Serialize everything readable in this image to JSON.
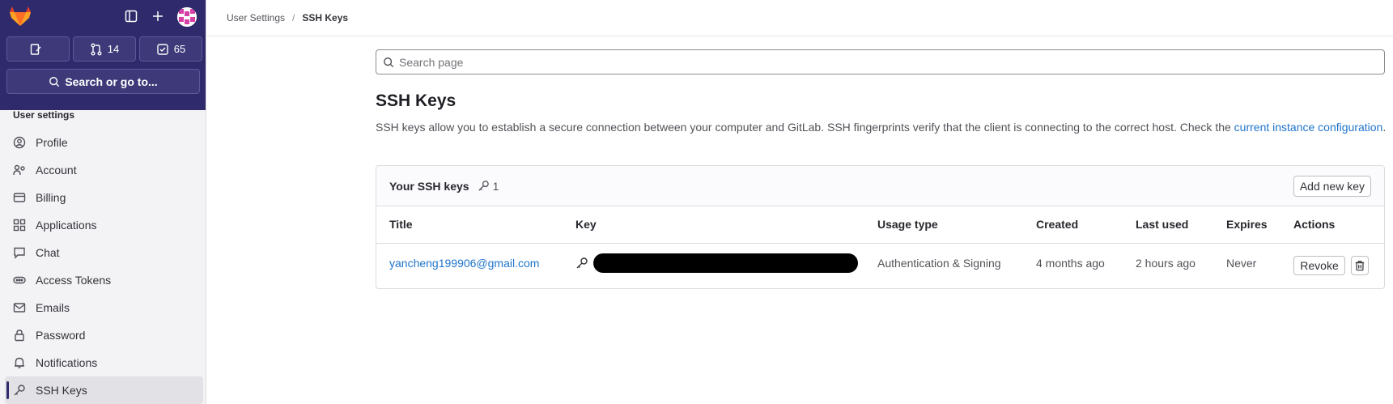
{
  "header": {
    "counters": [
      {
        "icon": "issues-icon",
        "value": ""
      },
      {
        "icon": "merge-request-icon",
        "value": "14"
      },
      {
        "icon": "todo-icon",
        "value": "65"
      }
    ],
    "search_label": "Search or go to..."
  },
  "sidebar": {
    "section_title": "User settings",
    "items": [
      {
        "label": "Profile",
        "icon": "profile-icon"
      },
      {
        "label": "Account",
        "icon": "account-icon"
      },
      {
        "label": "Billing",
        "icon": "billing-icon"
      },
      {
        "label": "Applications",
        "icon": "applications-icon"
      },
      {
        "label": "Chat",
        "icon": "chat-icon"
      },
      {
        "label": "Access Tokens",
        "icon": "token-icon"
      },
      {
        "label": "Emails",
        "icon": "mail-icon"
      },
      {
        "label": "Password",
        "icon": "lock-icon"
      },
      {
        "label": "Notifications",
        "icon": "bell-icon"
      },
      {
        "label": "SSH Keys",
        "icon": "key-icon",
        "active": true
      }
    ]
  },
  "breadcrumb": {
    "parent": "User Settings",
    "separator": "/",
    "current": "SSH Keys"
  },
  "page_search": {
    "placeholder": "Search page"
  },
  "page": {
    "title": "SSH Keys",
    "description": "SSH keys allow you to establish a secure connection between your computer and GitLab. SSH fingerprints verify that the client is connecting to the correct host. Check the ",
    "description_link": "current instance configuration",
    "description_end": "."
  },
  "keys_card": {
    "title": "Your SSH keys",
    "count": "1",
    "add_button": "Add new key",
    "columns": [
      "Title",
      "Key",
      "Usage type",
      "Created",
      "Last used",
      "Expires",
      "Actions"
    ],
    "rows": [
      {
        "title": "yancheng199906@gmail.com",
        "key": "",
        "usage_type": "Authentication & Signing",
        "created": "4 months ago",
        "last_used": "2 hours ago",
        "expires": "Never",
        "revoke_label": "Revoke"
      }
    ]
  },
  "colors": {
    "sidebar_top": "#2f2a6b",
    "link": "#1f75cb",
    "logo_orange": "#e24329"
  }
}
